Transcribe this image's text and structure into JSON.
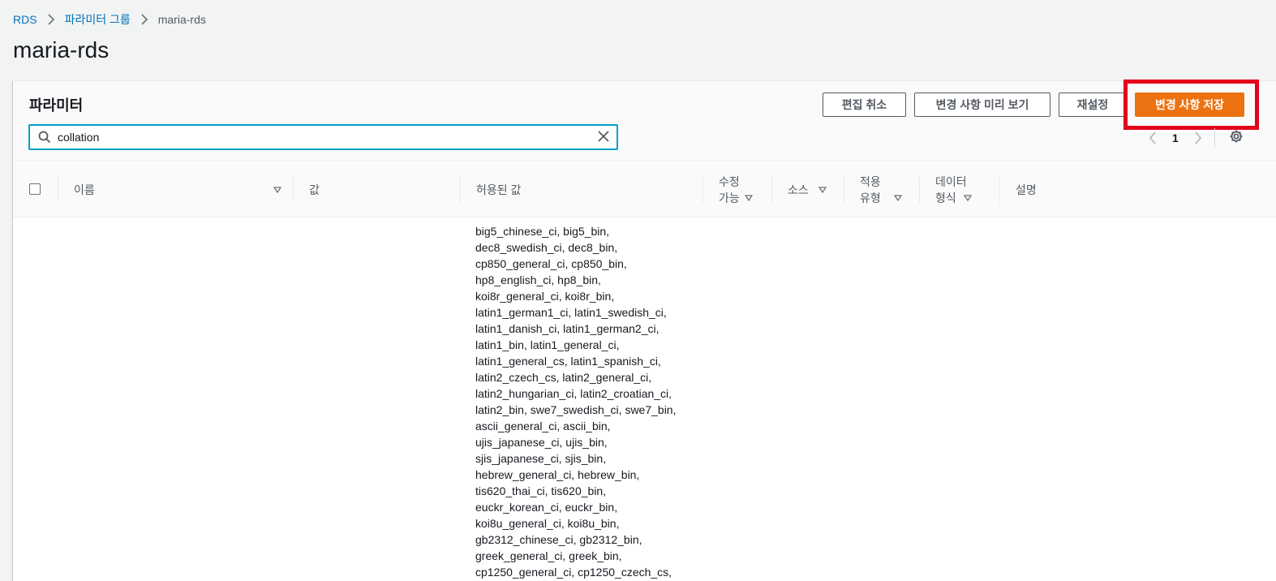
{
  "breadcrumb": {
    "items": [
      "RDS",
      "파라미터 그룹"
    ],
    "current": "maria-rds"
  },
  "page_title": "maria-rds",
  "panel": {
    "title": "파라미터",
    "buttons": {
      "cancel_edit": "편집 취소",
      "preview_changes": "변경 사항 미리 보기",
      "reset": "재설정",
      "save_changes": "변경 사항 저장"
    },
    "search": {
      "value": "collation"
    },
    "pagination": {
      "current_page": "1"
    }
  },
  "table": {
    "columns": {
      "name": "이름",
      "value": "값",
      "allowed": "허용된 값",
      "modifiable_1": "수정",
      "modifiable_2": "가능",
      "source": "소스",
      "apply_type_1": "적용",
      "apply_type_2": "유형",
      "data_type_1": "데이터",
      "data_type_2": "형식",
      "description": "설명"
    },
    "rows": [
      {
        "allowed_values": [
          "big5_chinese_ci, big5_bin,",
          "dec8_swedish_ci, dec8_bin,",
          "cp850_general_ci, cp850_bin,",
          "hp8_english_ci, hp8_bin,",
          "koi8r_general_ci, koi8r_bin,",
          "latin1_german1_ci, latin1_swedish_ci,",
          "latin1_danish_ci, latin1_german2_ci,",
          "latin1_bin, latin1_general_ci,",
          "latin1_general_cs, latin1_spanish_ci,",
          "latin2_czech_cs, latin2_general_ci,",
          "latin2_hungarian_ci, latin2_croatian_ci,",
          "latin2_bin, swe7_swedish_ci, swe7_bin,",
          "ascii_general_ci, ascii_bin,",
          "ujis_japanese_ci, ujis_bin,",
          "sjis_japanese_ci, sjis_bin,",
          "hebrew_general_ci, hebrew_bin,",
          "tis620_thai_ci, tis620_bin,",
          "euckr_korean_ci, euckr_bin,",
          "koi8u_general_ci, koi8u_bin,",
          "gb2312_chinese_ci, gb2312_bin,",
          "greek_general_ci, greek_bin,",
          "cp1250_general_ci, cp1250_czech_cs,"
        ]
      }
    ]
  },
  "colors": {
    "link": "#0073bb",
    "primary_button": "#ec7211",
    "highlight": "#e4001b",
    "focus_border": "#00a1c9"
  },
  "icons": [
    "chevron-right-icon",
    "search-icon",
    "close-icon",
    "chevron-left-icon",
    "gear-icon",
    "sort-caret-icon"
  ]
}
